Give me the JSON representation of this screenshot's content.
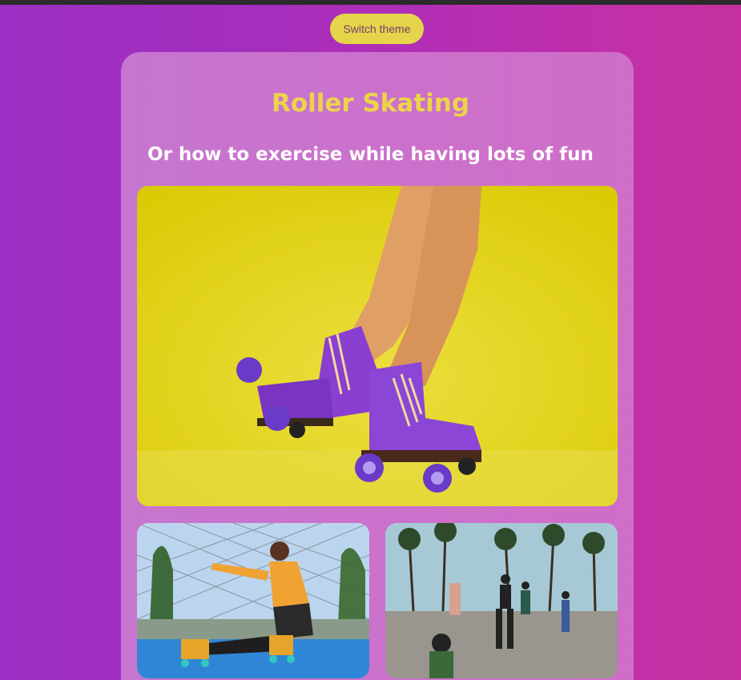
{
  "theme_toggle": {
    "label": "Switch theme"
  },
  "article": {
    "title": "Roller Skating",
    "subtitle": "Or how to exercise while having lots of fun"
  },
  "colors": {
    "background_start": "#9b2fc3",
    "background_end": "#c7319f",
    "button_bg": "#e6d44a",
    "title": "#ecd44a",
    "subtitle": "#ffffff",
    "skate_purple": "#7a3cc2"
  },
  "images": [
    {
      "name": "hero-roller-skates-photo"
    },
    {
      "name": "skater-sitting-on-blue-court-photo"
    },
    {
      "name": "boardwalk-skaters-photo"
    }
  ]
}
